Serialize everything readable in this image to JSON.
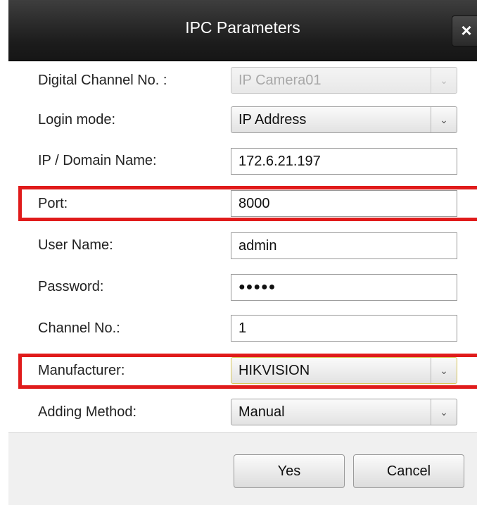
{
  "dialog": {
    "title": "IPC Parameters",
    "close_label": "×"
  },
  "form": {
    "digital_channel": {
      "label": "Digital Channel No. :",
      "value": "IP Camera01"
    },
    "login_mode": {
      "label": "Login mode:",
      "value": "IP Address"
    },
    "ip_domain": {
      "label": "IP / Domain Name:",
      "value": "172.6.21.197"
    },
    "port": {
      "label": "Port:",
      "value": "8000"
    },
    "user_name": {
      "label": "User Name:",
      "value": "admin"
    },
    "password": {
      "label": "Password:",
      "value": "●●●●●"
    },
    "channel_no": {
      "label": "Channel No.:",
      "value": "1"
    },
    "manufacturer": {
      "label": "Manufacturer:",
      "value": "HIKVISION"
    },
    "adding_method": {
      "label": "Adding Method:",
      "value": "Manual"
    }
  },
  "buttons": {
    "yes": "Yes",
    "cancel": "Cancel"
  },
  "icons": {
    "dropdown_arrow": "⌄"
  },
  "colors": {
    "highlight": "#e01b1b",
    "titlebar": "#1c1c1c"
  }
}
